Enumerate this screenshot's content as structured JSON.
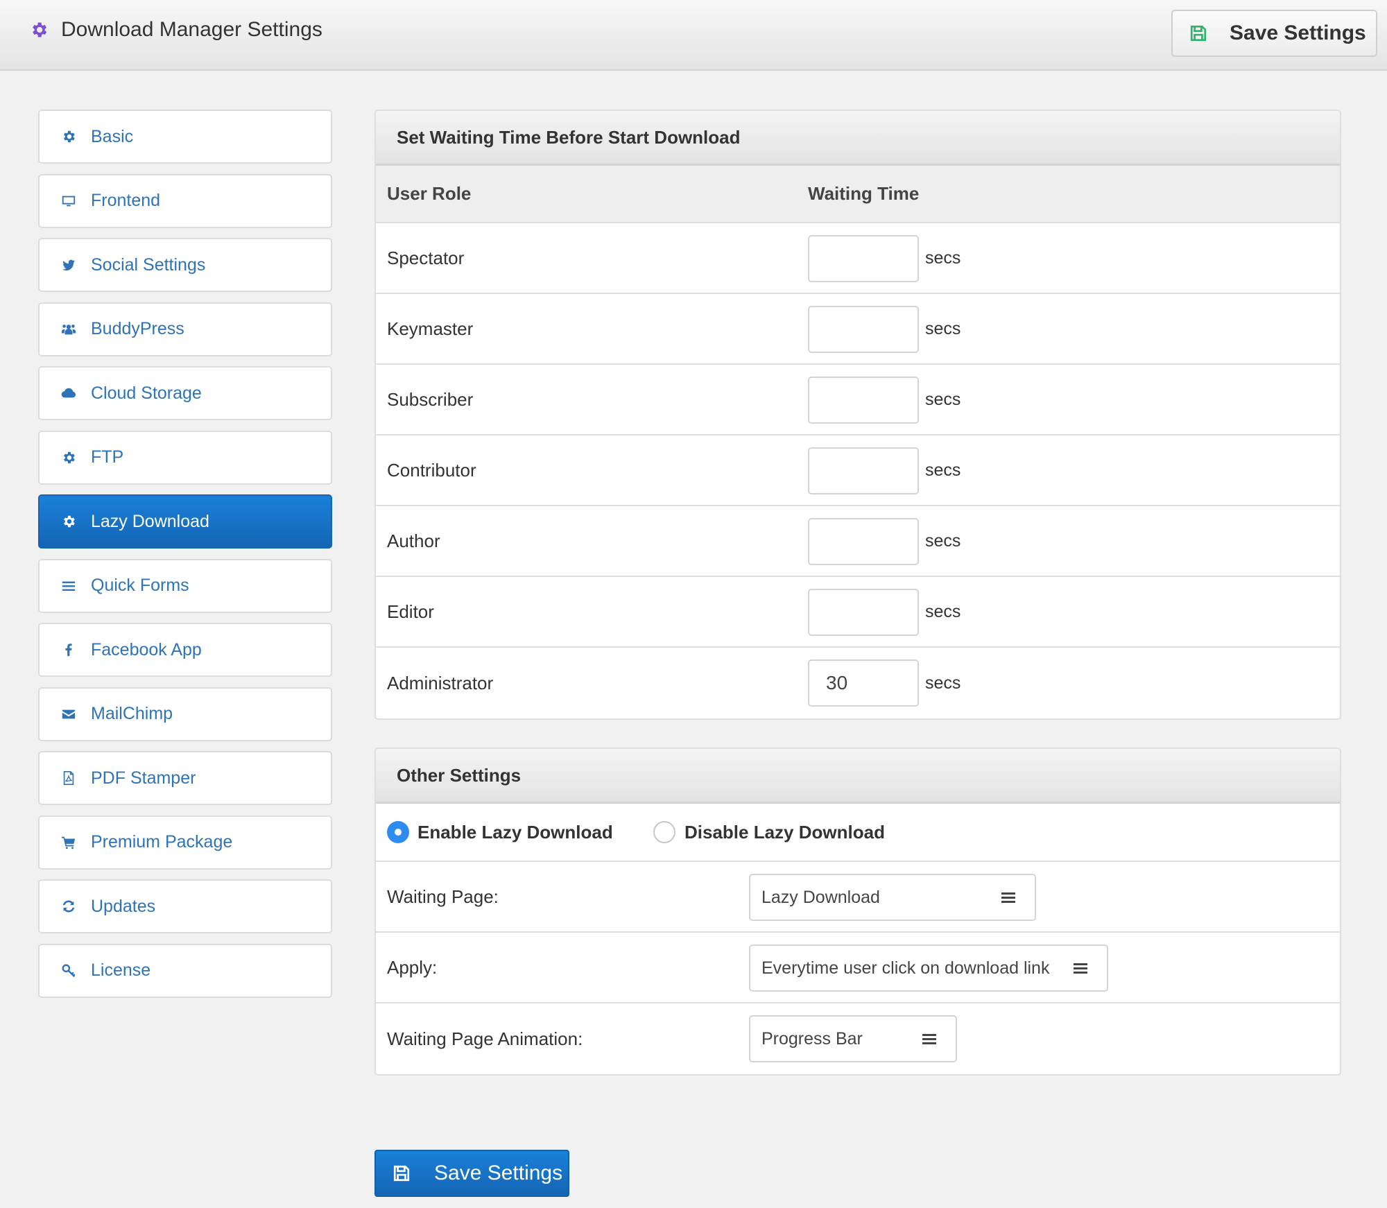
{
  "header": {
    "title": "Download Manager Settings",
    "title_icon": "gear-icon",
    "save_button": {
      "label": "Save Settings",
      "icon": "save-icon",
      "icon_color": "#2fb36a"
    }
  },
  "sidebar": {
    "active_index": 6,
    "items": [
      {
        "label": "Basic",
        "icon": "gear-icon"
      },
      {
        "label": "Frontend",
        "icon": "desktop-icon"
      },
      {
        "label": "Social Settings",
        "icon": "twitter-icon"
      },
      {
        "label": "BuddyPress",
        "icon": "users-icon"
      },
      {
        "label": "Cloud Storage",
        "icon": "cloud-icon"
      },
      {
        "label": "FTP",
        "icon": "gear-icon"
      },
      {
        "label": "Lazy Download",
        "icon": "gear-icon"
      },
      {
        "label": "Quick Forms",
        "icon": "bars-icon"
      },
      {
        "label": "Facebook App",
        "icon": "facebook-icon"
      },
      {
        "label": "MailChimp",
        "icon": "envelope-icon"
      },
      {
        "label": "PDF Stamper",
        "icon": "pdf-file-icon"
      },
      {
        "label": "Premium Package",
        "icon": "cart-icon"
      },
      {
        "label": "Updates",
        "icon": "refresh-icon"
      },
      {
        "label": "License",
        "icon": "key-icon"
      }
    ]
  },
  "waiting_panel": {
    "title": "Set Waiting Time Before Start Download",
    "columns": [
      "User Role",
      "Waiting Time"
    ],
    "unit": "secs",
    "rows": [
      {
        "role": "Spectator",
        "value": ""
      },
      {
        "role": "Keymaster",
        "value": ""
      },
      {
        "role": "Subscriber",
        "value": ""
      },
      {
        "role": "Contributor",
        "value": ""
      },
      {
        "role": "Author",
        "value": ""
      },
      {
        "role": "Editor",
        "value": ""
      },
      {
        "role": "Administrator",
        "value": "30"
      }
    ]
  },
  "other_panel": {
    "title": "Other Settings",
    "radios": [
      {
        "label": "Enable Lazy Download",
        "checked": true
      },
      {
        "label": "Disable Lazy Download",
        "checked": false
      }
    ],
    "options": [
      {
        "label": "Waiting Page:",
        "value": "Lazy Download"
      },
      {
        "label": "Apply:",
        "value": "Everytime user click on download link"
      },
      {
        "label": "Waiting Page Animation:",
        "value": "Progress Bar"
      }
    ]
  },
  "footer": {
    "save_button": {
      "label": "Save Settings",
      "icon": "save-icon"
    }
  },
  "colors": {
    "accent": "#1a73c8",
    "link": "#2e73b8",
    "title_icon": "#7b4fd6",
    "radio_on": "#2d8cf0"
  }
}
